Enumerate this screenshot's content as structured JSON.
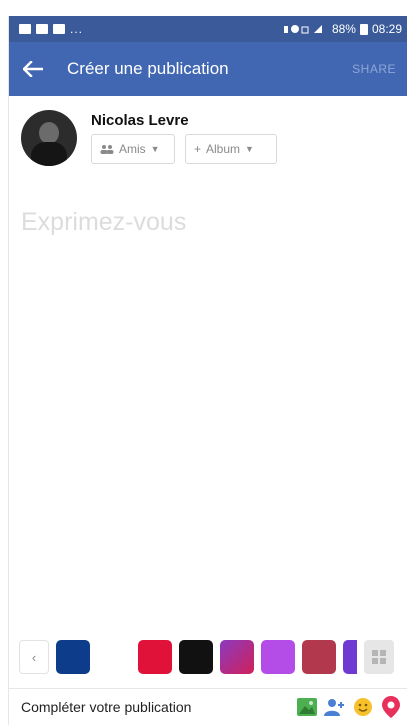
{
  "status_bar": {
    "dots": "...",
    "right_text": "88%",
    "time": "08:29",
    "color": "#3b5a9a"
  },
  "app_bar": {
    "title": "Créer une publication",
    "share_label": "SHARE",
    "back_icon": "arrow-left-icon",
    "color": "#4267b2"
  },
  "composer": {
    "author_name": "Nicolas Levre",
    "audience_label": "Amis",
    "audience_icon": "friends-icon",
    "album_label": "Album",
    "album_icon": "plus-icon",
    "placeholder": "Exprimez-vous"
  },
  "background_picker": {
    "back_icon": "chevron-left-icon",
    "swatch_colors": [
      "#0d3d8a",
      "#ffffff",
      "#e0123a",
      "#111111",
      "#8a3bbf",
      "#b44de8",
      "#b2394d",
      "#6f3ad1"
    ],
    "grid_icon": "grid-icon"
  },
  "footer": {
    "label": "Compléter votre publication",
    "icons": [
      "photo-icon",
      "tag-people-icon",
      "feeling-icon",
      "location-icon"
    ]
  }
}
